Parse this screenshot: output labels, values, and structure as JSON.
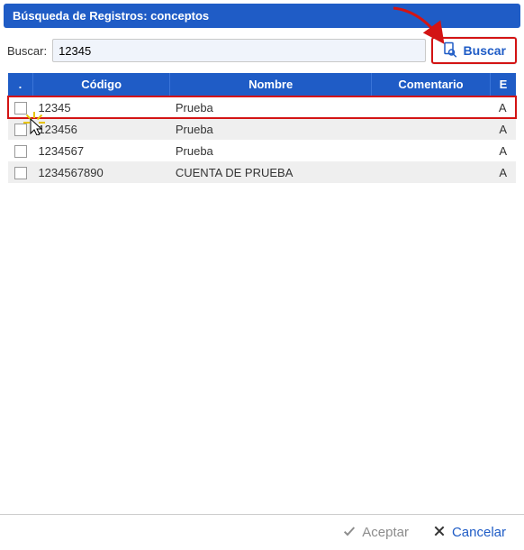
{
  "title": "Búsqueda de Registros: conceptos",
  "search": {
    "label": "Buscar:",
    "value": "12345",
    "button_label": "Buscar"
  },
  "table": {
    "headers": {
      "sel": ".",
      "codigo": "Código",
      "nombre": "Nombre",
      "comentario": "Comentario",
      "e": "E"
    },
    "rows": [
      {
        "codigo": "12345",
        "nombre": "Prueba",
        "comentario": "",
        "e": "A",
        "selected": true
      },
      {
        "codigo": "123456",
        "nombre": "Prueba",
        "comentario": "",
        "e": "A",
        "selected": false
      },
      {
        "codigo": "1234567",
        "nombre": "Prueba",
        "comentario": "",
        "e": "A",
        "selected": false
      },
      {
        "codigo": "1234567890",
        "nombre": "CUENTA DE PRUEBA",
        "comentario": "",
        "e": "A",
        "selected": false
      }
    ]
  },
  "footer": {
    "accept": "Aceptar",
    "cancel": "Cancelar"
  }
}
